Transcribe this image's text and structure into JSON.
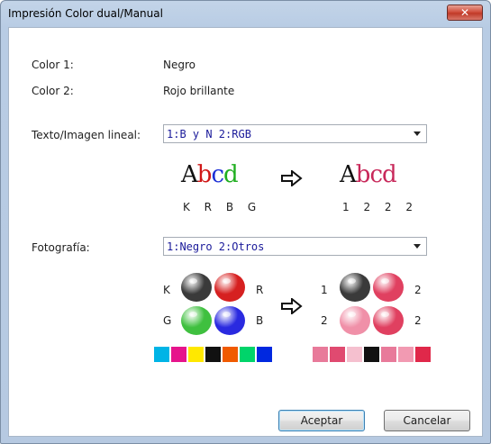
{
  "window": {
    "title": "Impresión Color dual/Manual",
    "close_glyph": "✕"
  },
  "color1": {
    "label": "Color 1:",
    "value": "Negro"
  },
  "color2": {
    "label": "Color 2:",
    "value": "Rojo brillante"
  },
  "text_image": {
    "label": "Texto/Imagen lineal:",
    "selected": "1:B y N 2:RGB",
    "sample_before": {
      "letters": [
        "A",
        "b",
        "c",
        "d"
      ],
      "colors": [
        "#111111",
        "#d01818",
        "#1c2fd6",
        "#1fae1f"
      ],
      "caption": "K R B G"
    },
    "sample_after": {
      "letters": [
        "A",
        "b",
        "c",
        "d"
      ],
      "colors": [
        "#111111",
        "#c8285a",
        "#c8285a",
        "#c8285a"
      ],
      "caption": "1 2 2 2"
    },
    "arrow_icon": "arrow-right-icon"
  },
  "photo": {
    "label": "Fotografía:",
    "selected": "1:Negro 2:Otros",
    "before_labels": {
      "tl": "K",
      "tr": "R",
      "bl": "G",
      "br": "B"
    },
    "after_labels": {
      "tl": "1",
      "tr": "2",
      "bl": "2",
      "br": "2"
    },
    "before_colors": [
      "#3a3a3a",
      "#d62020",
      "#3fc03f",
      "#2a2ae0"
    ],
    "after_colors": [
      "#3a3a3a",
      "#e04060",
      "#f090a8",
      "#e04060"
    ],
    "before_strip": [
      "#00b4e6",
      "#e6148c",
      "#ffe800",
      "#111111",
      "#f05a00",
      "#00d46a",
      "#0028e0"
    ],
    "after_strip": [
      "#e87a9a",
      "#e04a70",
      "#f5c0cf",
      "#111111",
      "#e87a9a",
      "#f29ab2",
      "#e0284a"
    ]
  },
  "buttons": {
    "accept": "Aceptar",
    "cancel": "Cancelar"
  }
}
